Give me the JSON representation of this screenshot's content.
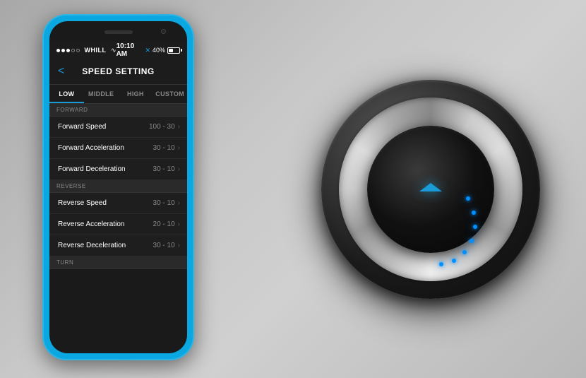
{
  "scene": {
    "bg_color": "#b0b0b0"
  },
  "phone": {
    "status_bar": {
      "carrier": "WHILL",
      "time": "10:10 AM",
      "battery_percent": "40%"
    },
    "nav": {
      "title": "SPEED SETTING",
      "back_label": "<"
    },
    "tabs": [
      {
        "label": "LOW",
        "active": true
      },
      {
        "label": "MIDDLE",
        "active": false
      },
      {
        "label": "HIGH",
        "active": false
      },
      {
        "label": "CUSTOM",
        "active": false
      }
    ],
    "sections": [
      {
        "header": "FORWARD",
        "rows": [
          {
            "label": "Forward Speed",
            "value": "100 - 30"
          },
          {
            "label": "Forward Acceleration",
            "value": "30 - 10"
          },
          {
            "label": "Forward Deceleration",
            "value": "30 - 10"
          }
        ]
      },
      {
        "header": "REVERSE",
        "rows": [
          {
            "label": "Reverse Speed",
            "value": "30 - 10"
          },
          {
            "label": "Reverse Acceleration",
            "value": "20 - 10"
          },
          {
            "label": "Reverse Deceleration",
            "value": "30 - 10"
          }
        ]
      },
      {
        "header": "TURN",
        "rows": []
      }
    ]
  }
}
